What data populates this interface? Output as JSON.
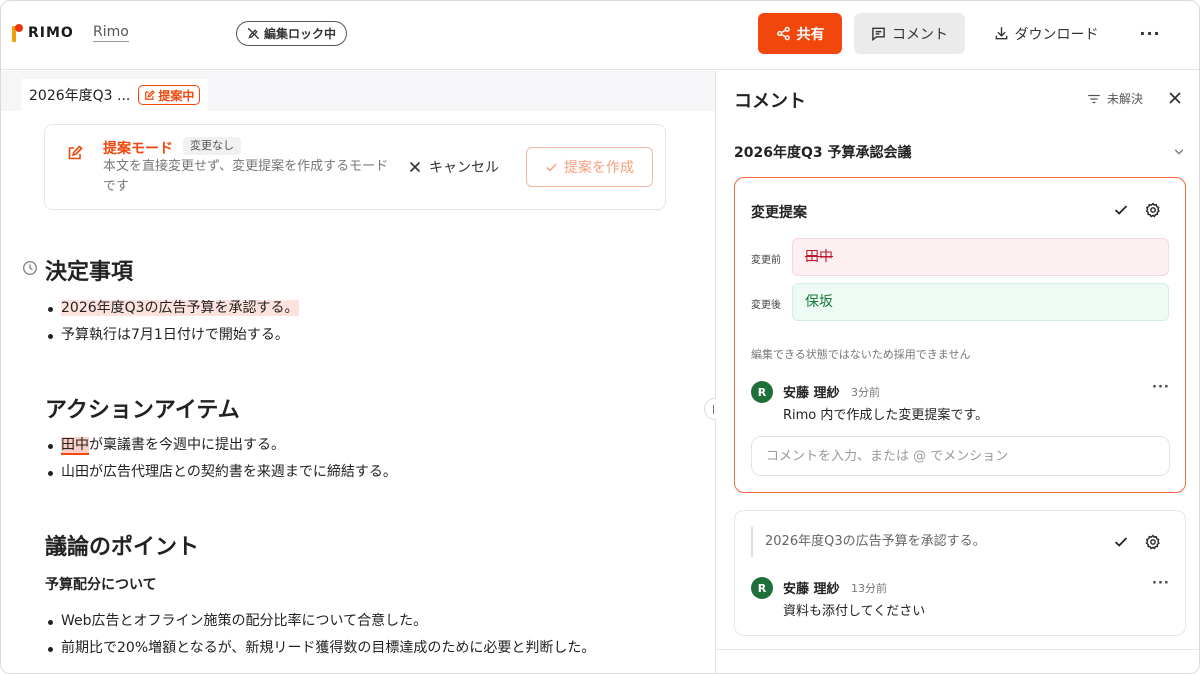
{
  "header": {
    "logo_text": "RIMO",
    "doc_name": "Rimo",
    "lock_badge": "編集ロック中",
    "share_label": "共有",
    "comment_label": "コメント",
    "download_label": "ダウンロード",
    "more_label": "···"
  },
  "editor": {
    "tab_title": "2026年度Q3 ...",
    "tab_badge": "提案中",
    "mode": {
      "title": "提案モード",
      "chip": "変更なし",
      "desc": "本文を直接変更せず、変更提案を作成するモードです",
      "cancel_label": "キャンセル",
      "create_label": "提案を作成"
    },
    "sections": [
      {
        "heading": "決定事項",
        "items": [
          "2026年度Q3の広告予算を承認する。",
          "予算執行は7月1日付けで開始する。"
        ]
      },
      {
        "heading": "アクションアイテム",
        "item1_highlight": "田中",
        "item1_rest": "が稟議書を今週中に提出する。",
        "items": [
          "山田が広告代理店との契約書を来週までに締結する。"
        ]
      },
      {
        "heading": "議論のポイント",
        "subheading": "予算配分について",
        "items": [
          "Web広告とオフライン施策の配分比率について合意した。",
          "前期比で20%増額となるが、新規リード獲得数の目標達成のために必要と判断した。"
        ]
      }
    ]
  },
  "comments_panel": {
    "title": "コメント",
    "filter_label": "未解決",
    "section_title": "2026年度Q3 予算承認会議",
    "active_card": {
      "title": "変更提案",
      "before_label": "変更前",
      "before_value": "田中",
      "after_label": "変更後",
      "after_value": "保坂",
      "note": "編集できる状態ではないため採用できません",
      "comment": {
        "avatar": "R",
        "author": "安藤 理紗",
        "time": "3分前",
        "text": "Rimo 内で作成した変更提案です。"
      },
      "input_placeholder": "コメントを入力、または @ でメンション"
    },
    "second_card": {
      "quote": "2026年度Q3の広告予算を承認する。",
      "comment": {
        "avatar": "R",
        "author": "安藤 理紗",
        "time": "13分前",
        "text": "資料も添付してください"
      }
    }
  },
  "colors": {
    "accent": "#f2470c",
    "avatar_green": "#1f6f3a",
    "before_red": "#c0142a",
    "after_green": "#1a7a3b"
  }
}
